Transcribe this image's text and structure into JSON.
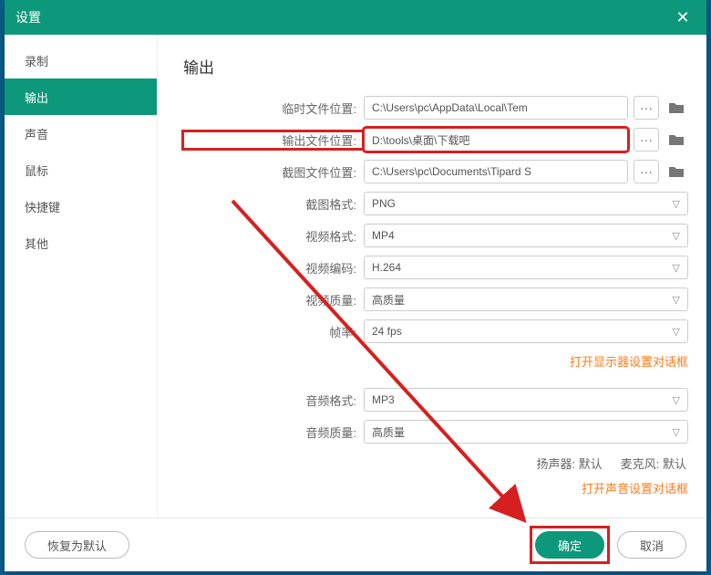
{
  "titlebar": {
    "title": "设置"
  },
  "sidebar": {
    "items": [
      {
        "label": "录制"
      },
      {
        "label": "输出"
      },
      {
        "label": "声音"
      },
      {
        "label": "鼠标"
      },
      {
        "label": "快捷键"
      },
      {
        "label": "其他"
      }
    ],
    "active_index": 1
  },
  "output": {
    "title": "输出",
    "temp_label": "临时文件位置:",
    "temp_value": "C:\\Users\\pc\\AppData\\Local\\Tem",
    "out_label": "输出文件位置:",
    "out_value": "D:\\tools\\桌面\\下载吧",
    "shot_label": "截图文件位置:",
    "shot_value": "C:\\Users\\pc\\Documents\\Tipard S",
    "shot_fmt_label": "截图格式:",
    "shot_fmt_value": "PNG",
    "vid_fmt_label": "视频格式:",
    "vid_fmt_value": "MP4",
    "vid_enc_label": "视频编码:",
    "vid_enc_value": "H.264",
    "vid_q_label": "视频质量:",
    "vid_q_value": "高质量",
    "fps_label": "帧率:",
    "fps_value": "24 fps",
    "display_link": "打开显示器设置对话框",
    "aud_fmt_label": "音频格式:",
    "aud_fmt_value": "MP3",
    "aud_q_label": "音频质量:",
    "aud_q_value": "高质量",
    "speaker_label": "扬声器:",
    "speaker_value": "默认",
    "mic_label": "麦克风:",
    "mic_value": "默认",
    "sound_link": "打开声音设置对话框"
  },
  "sound": {
    "title": "声音"
  },
  "footer": {
    "restore": "恢复为默认",
    "ok": "确定",
    "cancel": "取消"
  }
}
